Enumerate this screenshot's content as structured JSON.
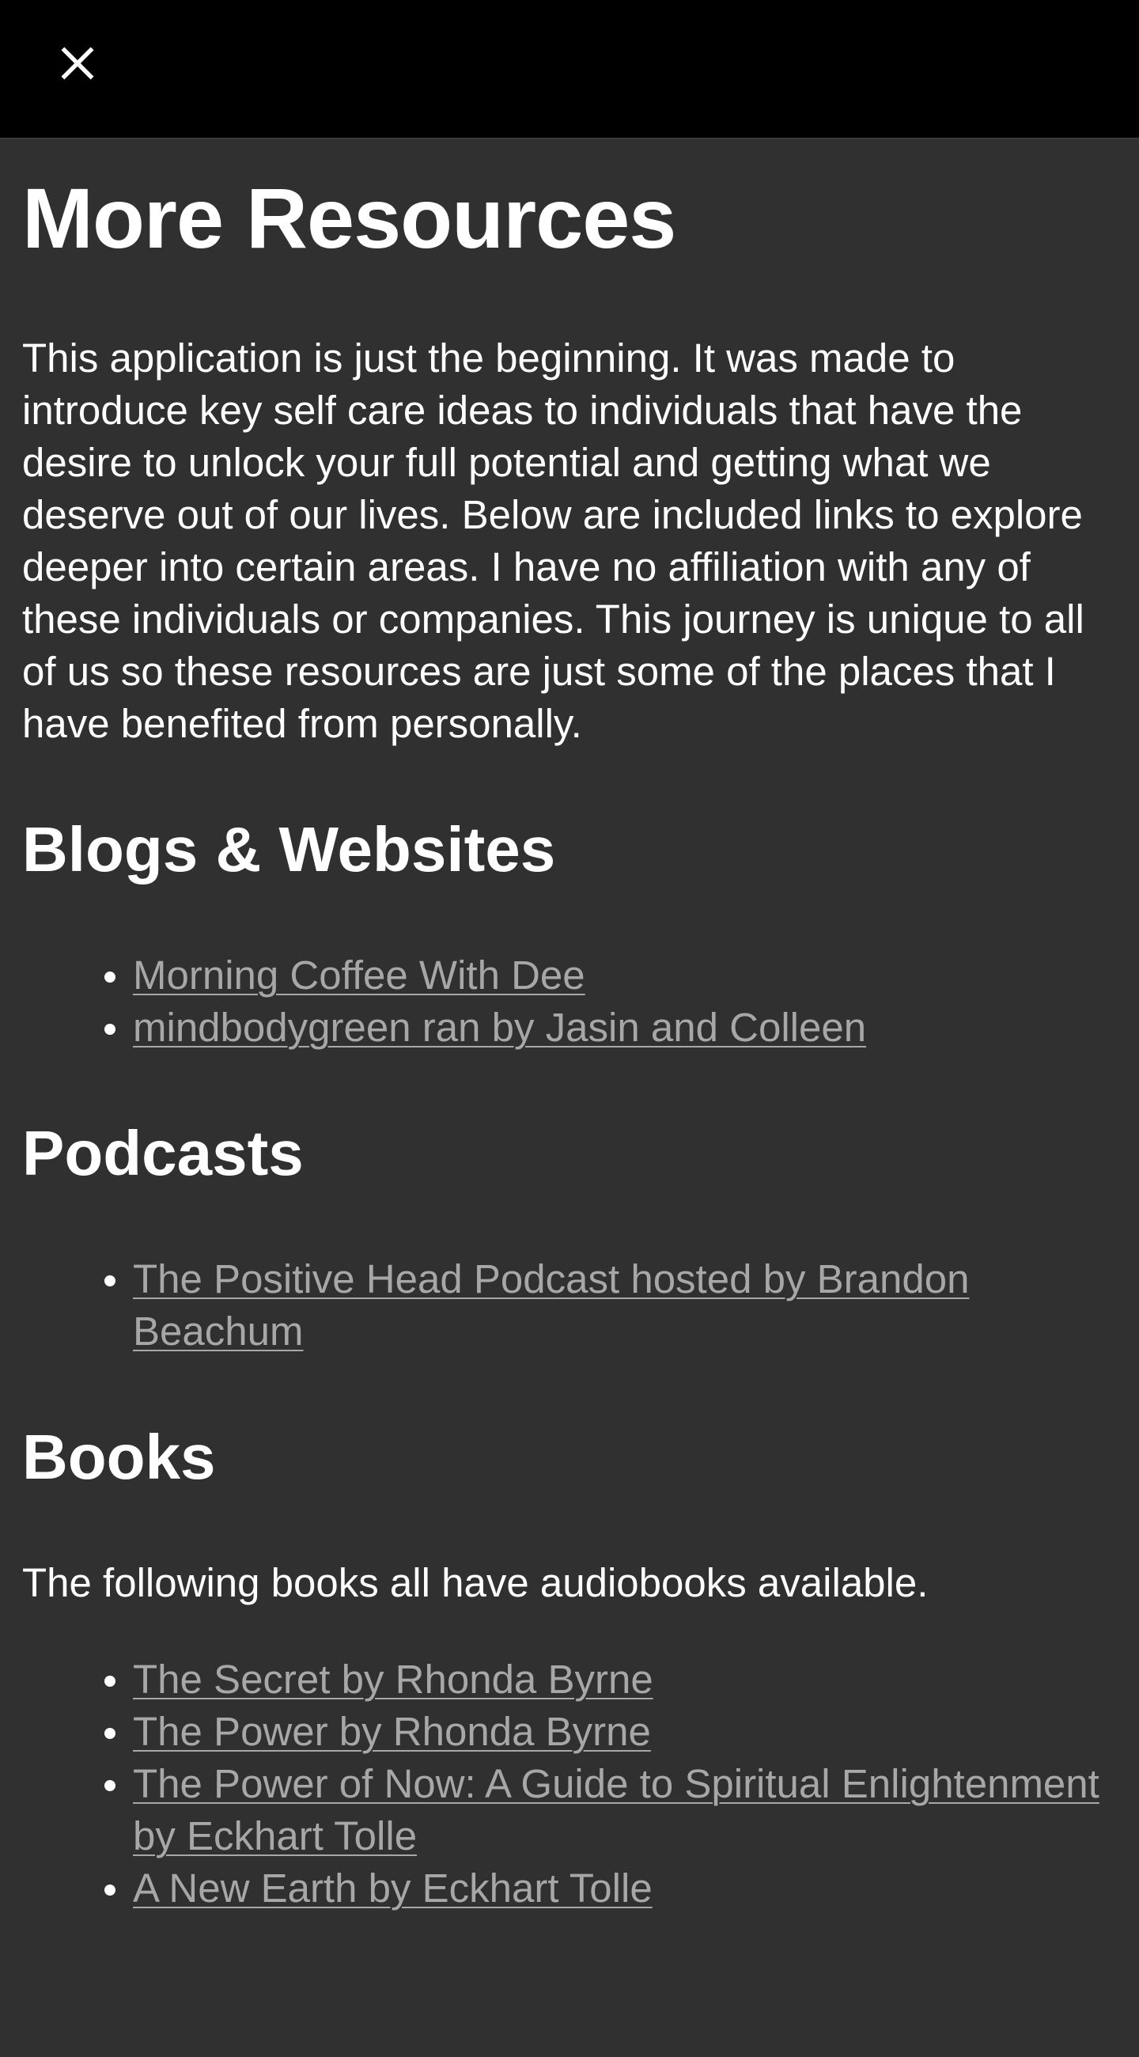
{
  "toolbar": {
    "close_icon": "close-icon"
  },
  "page": {
    "title": "More Resources",
    "intro": "This application is just the beginning. It was made to introduce key self care ideas to individuals that have the desire to unlock your full potential and getting what we deserve out of our lives. Below are included links to explore deeper into certain areas. I have no affiliation with any of these individuals or companies. This journey is unique to all of us so these resources are just some of the places that I have benefited from personally."
  },
  "sections": {
    "blogs": {
      "heading": "Blogs & Websites",
      "links": [
        "Morning Coffee With Dee",
        "mindbodygreen ran by Jasin and Colleen"
      ]
    },
    "podcasts": {
      "heading": "Podcasts",
      "links": [
        "The Positive Head Podcast hosted by Brandon Beachum"
      ]
    },
    "books": {
      "heading": "Books",
      "note": "The following books all have audiobooks available.",
      "links": [
        "The Secret by Rhonda Byrne",
        "The Power by Rhonda Byrne",
        "The Power of Now: A Guide to Spiritual Enlightenment by Eckhart Tolle",
        "A New Earth by Eckhart Tolle"
      ]
    }
  },
  "colors": {
    "background": "#303030",
    "top_bar": "#000000",
    "text": "#ffffff",
    "link": "#a7a7a7"
  }
}
